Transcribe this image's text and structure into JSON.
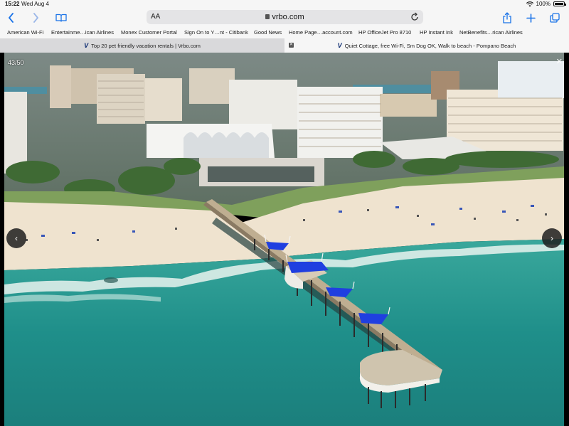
{
  "status_bar": {
    "time": "15:22",
    "date": "Wed Aug 4",
    "battery": "100%"
  },
  "address_bar": {
    "text_size_label": "AA",
    "domain": "vrbo.com"
  },
  "bookmarks": [
    "American Wi-Fi",
    "Entertainme…ican Airlines",
    "Monex Customer Portal",
    "Sign On to Y…nt - Citibank",
    "Good News",
    "Home Page…account.com",
    "HP OfficeJet Pro 8710",
    "HP Instant Ink",
    "NetBenefits…rican Airlines"
  ],
  "tabs": [
    {
      "title": "Top 20 pet friendly vacation rentals | Vrbo.com",
      "favicon": "V",
      "active": false
    },
    {
      "title": "Quiet Cottage, free Wi-Fi, Sm Dog OK, Walk to beach - Pompano Beach",
      "favicon": "V",
      "active": true
    }
  ],
  "gallery": {
    "counter": "43/50",
    "close": "✕",
    "prev": "‹",
    "next": "›"
  },
  "icons": {
    "back": "back-arrow-icon",
    "forward": "forward-arrow-icon",
    "book": "bookmarks-book-icon",
    "reload": "reload-icon",
    "share": "share-icon",
    "new_tab": "plus-icon",
    "tabs": "tabs-overview-icon"
  },
  "colors": {
    "system_blue": "#1a73e8",
    "ocean": "#1e8f8c",
    "sand": "#efe3cf",
    "canopy_blue": "#1f3fe0"
  }
}
